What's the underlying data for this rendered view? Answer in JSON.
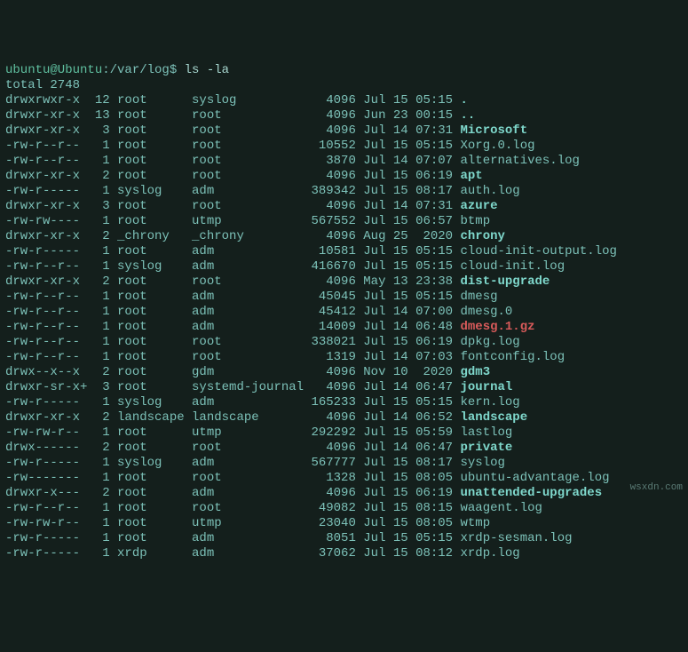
{
  "prompt": {
    "user": "ubuntu@Ubuntu",
    "path": "/var/log",
    "cmd": "ls -la"
  },
  "total": "total 2748",
  "rows": [
    {
      "perm": "drwxrwxr-x ",
      "lnk": "12",
      "own": "root     ",
      "grp": "syslog         ",
      "size": "  4096",
      "date": "Jul 15 05:15",
      "name": ".",
      "cls": "dir"
    },
    {
      "perm": "drwxr-xr-x ",
      "lnk": "13",
      "own": "root     ",
      "grp": "root           ",
      "size": "  4096",
      "date": "Jun 23 00:15",
      "name": "..",
      "cls": "dir"
    },
    {
      "perm": "drwxr-xr-x ",
      "lnk": " 3",
      "own": "root     ",
      "grp": "root           ",
      "size": "  4096",
      "date": "Jul 14 07:31",
      "name": "Microsoft",
      "cls": "dir"
    },
    {
      "perm": "-rw-r--r-- ",
      "lnk": " 1",
      "own": "root     ",
      "grp": "root           ",
      "size": " 10552",
      "date": "Jul 15 05:15",
      "name": "Xorg.0.log",
      "cls": "file"
    },
    {
      "perm": "-rw-r--r-- ",
      "lnk": " 1",
      "own": "root     ",
      "grp": "root           ",
      "size": "  3870",
      "date": "Jul 14 07:07",
      "name": "alternatives.log",
      "cls": "file"
    },
    {
      "perm": "drwxr-xr-x ",
      "lnk": " 2",
      "own": "root     ",
      "grp": "root           ",
      "size": "  4096",
      "date": "Jul 15 06:19",
      "name": "apt",
      "cls": "dir"
    },
    {
      "perm": "-rw-r----- ",
      "lnk": " 1",
      "own": "syslog   ",
      "grp": "adm            ",
      "size": "389342",
      "date": "Jul 15 08:17",
      "name": "auth.log",
      "cls": "file"
    },
    {
      "perm": "drwxr-xr-x ",
      "lnk": " 3",
      "own": "root     ",
      "grp": "root           ",
      "size": "  4096",
      "date": "Jul 14 07:31",
      "name": "azure",
      "cls": "dir"
    },
    {
      "perm": "-rw-rw---- ",
      "lnk": " 1",
      "own": "root     ",
      "grp": "utmp           ",
      "size": "567552",
      "date": "Jul 15 06:57",
      "name": "btmp",
      "cls": "file"
    },
    {
      "perm": "drwxr-xr-x ",
      "lnk": " 2",
      "own": "_chrony  ",
      "grp": "_chrony        ",
      "size": "  4096",
      "date": "Aug 25  2020",
      "name": "chrony",
      "cls": "dir"
    },
    {
      "perm": "-rw-r----- ",
      "lnk": " 1",
      "own": "root     ",
      "grp": "adm            ",
      "size": " 10581",
      "date": "Jul 15 05:15",
      "name": "cloud-init-output.log",
      "cls": "file"
    },
    {
      "perm": "-rw-r--r-- ",
      "lnk": " 1",
      "own": "syslog   ",
      "grp": "adm            ",
      "size": "416670",
      "date": "Jul 15 05:15",
      "name": "cloud-init.log",
      "cls": "file"
    },
    {
      "perm": "drwxr-xr-x ",
      "lnk": " 2",
      "own": "root     ",
      "grp": "root           ",
      "size": "  4096",
      "date": "May 13 23:38",
      "name": "dist-upgrade",
      "cls": "dir"
    },
    {
      "perm": "-rw-r--r-- ",
      "lnk": " 1",
      "own": "root     ",
      "grp": "adm            ",
      "size": " 45045",
      "date": "Jul 15 05:15",
      "name": "dmesg",
      "cls": "file"
    },
    {
      "perm": "-rw-r--r-- ",
      "lnk": " 1",
      "own": "root     ",
      "grp": "adm            ",
      "size": " 45412",
      "date": "Jul 14 07:00",
      "name": "dmesg.0",
      "cls": "file"
    },
    {
      "perm": "-rw-r--r-- ",
      "lnk": " 1",
      "own": "root     ",
      "grp": "adm            ",
      "size": " 14009",
      "date": "Jul 14 06:48",
      "name": "dmesg.1.gz",
      "cls": "archive"
    },
    {
      "perm": "-rw-r--r-- ",
      "lnk": " 1",
      "own": "root     ",
      "grp": "root           ",
      "size": "338021",
      "date": "Jul 15 06:19",
      "name": "dpkg.log",
      "cls": "file"
    },
    {
      "perm": "-rw-r--r-- ",
      "lnk": " 1",
      "own": "root     ",
      "grp": "root           ",
      "size": "  1319",
      "date": "Jul 14 07:03",
      "name": "fontconfig.log",
      "cls": "file"
    },
    {
      "perm": "drwx--x--x ",
      "lnk": " 2",
      "own": "root     ",
      "grp": "gdm            ",
      "size": "  4096",
      "date": "Nov 10  2020",
      "name": "gdm3",
      "cls": "dir"
    },
    {
      "perm": "drwxr-sr-x+",
      "lnk": " 3",
      "own": "root     ",
      "grp": "systemd-journal",
      "size": "  4096",
      "date": "Jul 14 06:47",
      "name": "journal",
      "cls": "dir"
    },
    {
      "perm": "-rw-r----- ",
      "lnk": " 1",
      "own": "syslog   ",
      "grp": "adm            ",
      "size": "165233",
      "date": "Jul 15 05:15",
      "name": "kern.log",
      "cls": "file"
    },
    {
      "perm": "drwxr-xr-x ",
      "lnk": " 2",
      "own": "landscape",
      "grp": "landscape      ",
      "size": "  4096",
      "date": "Jul 14 06:52",
      "name": "landscape",
      "cls": "dir"
    },
    {
      "perm": "-rw-rw-r-- ",
      "lnk": " 1",
      "own": "root     ",
      "grp": "utmp           ",
      "size": "292292",
      "date": "Jul 15 05:59",
      "name": "lastlog",
      "cls": "file"
    },
    {
      "perm": "drwx------ ",
      "lnk": " 2",
      "own": "root     ",
      "grp": "root           ",
      "size": "  4096",
      "date": "Jul 14 06:47",
      "name": "private",
      "cls": "dir"
    },
    {
      "perm": "-rw-r----- ",
      "lnk": " 1",
      "own": "syslog   ",
      "grp": "adm            ",
      "size": "567777",
      "date": "Jul 15 08:17",
      "name": "syslog",
      "cls": "file"
    },
    {
      "perm": "-rw------- ",
      "lnk": " 1",
      "own": "root     ",
      "grp": "root           ",
      "size": "  1328",
      "date": "Jul 15 08:05",
      "name": "ubuntu-advantage.log",
      "cls": "file"
    },
    {
      "perm": "drwxr-x--- ",
      "lnk": " 2",
      "own": "root     ",
      "grp": "adm            ",
      "size": "  4096",
      "date": "Jul 15 06:19",
      "name": "unattended-upgrades",
      "cls": "dir"
    },
    {
      "perm": "-rw-r--r-- ",
      "lnk": " 1",
      "own": "root     ",
      "grp": "root           ",
      "size": " 49082",
      "date": "Jul 15 08:15",
      "name": "waagent.log",
      "cls": "file"
    },
    {
      "perm": "-rw-rw-r-- ",
      "lnk": " 1",
      "own": "root     ",
      "grp": "utmp           ",
      "size": " 23040",
      "date": "Jul 15 08:05",
      "name": "wtmp",
      "cls": "file"
    },
    {
      "perm": "-rw-r----- ",
      "lnk": " 1",
      "own": "root     ",
      "grp": "adm            ",
      "size": "  8051",
      "date": "Jul 15 05:15",
      "name": "xrdp-sesman.log",
      "cls": "file"
    },
    {
      "perm": "-rw-r----- ",
      "lnk": " 1",
      "own": "xrdp     ",
      "grp": "adm            ",
      "size": " 37062",
      "date": "Jul 15 08:12",
      "name": "xrdp.log",
      "cls": "file"
    }
  ],
  "watermark": "wsxdn.com"
}
